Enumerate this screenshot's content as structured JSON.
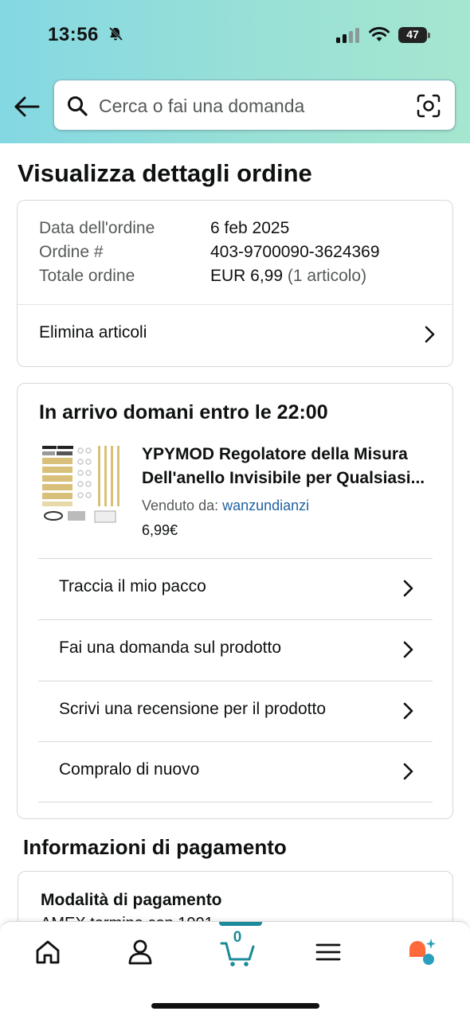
{
  "status_bar": {
    "time": "13:56",
    "battery_level": "47",
    "icons": [
      "bell-slash-icon",
      "signal-icon",
      "wifi-icon",
      "battery-icon"
    ]
  },
  "header": {
    "back_icon": "arrow-left-icon",
    "search_placeholder": "Cerca o fai una domanda",
    "search_icon": "magnifier-icon",
    "camera_icon": "camera-scan-icon"
  },
  "page": {
    "title": "Visualizza dettagli ordine"
  },
  "order_summary": {
    "date_label": "Data dell'ordine",
    "date_value": "6 feb 2025",
    "number_label": "Ordine #",
    "number_value": "403-9700090-3624369",
    "total_label": "Totale ordine",
    "total_value": "EUR 6,99",
    "total_count": "(1 articolo)",
    "delete_items_label": "Elimina articoli"
  },
  "delivery": {
    "title": "In arrivo domani entro le 22:00",
    "product": {
      "title_line1": "YPYMOD Regolatore della Misura",
      "title_line2": "Dell'anello Invisibile per Qualsiasi...",
      "sold_by_label": "Venduto da:",
      "seller": "wanzundianzi",
      "price": "6,99€"
    },
    "actions": [
      {
        "label": "Traccia il mio pacco"
      },
      {
        "label": "Fai una domanda sul prodotto"
      },
      {
        "label": "Scrivi una recensione per il prodotto"
      },
      {
        "label": "Compralo di nuovo"
      }
    ]
  },
  "payment": {
    "section_title": "Informazioni di pagamento",
    "method_title": "Modalità di pagamento",
    "method_detail": "AMEX termina con 1001"
  },
  "bottom_nav": {
    "items": [
      "home-icon",
      "account-icon",
      "cart-icon",
      "menu-icon",
      "rufus-icon"
    ],
    "cart_count": "0",
    "accent_color": "#1b8a99"
  }
}
